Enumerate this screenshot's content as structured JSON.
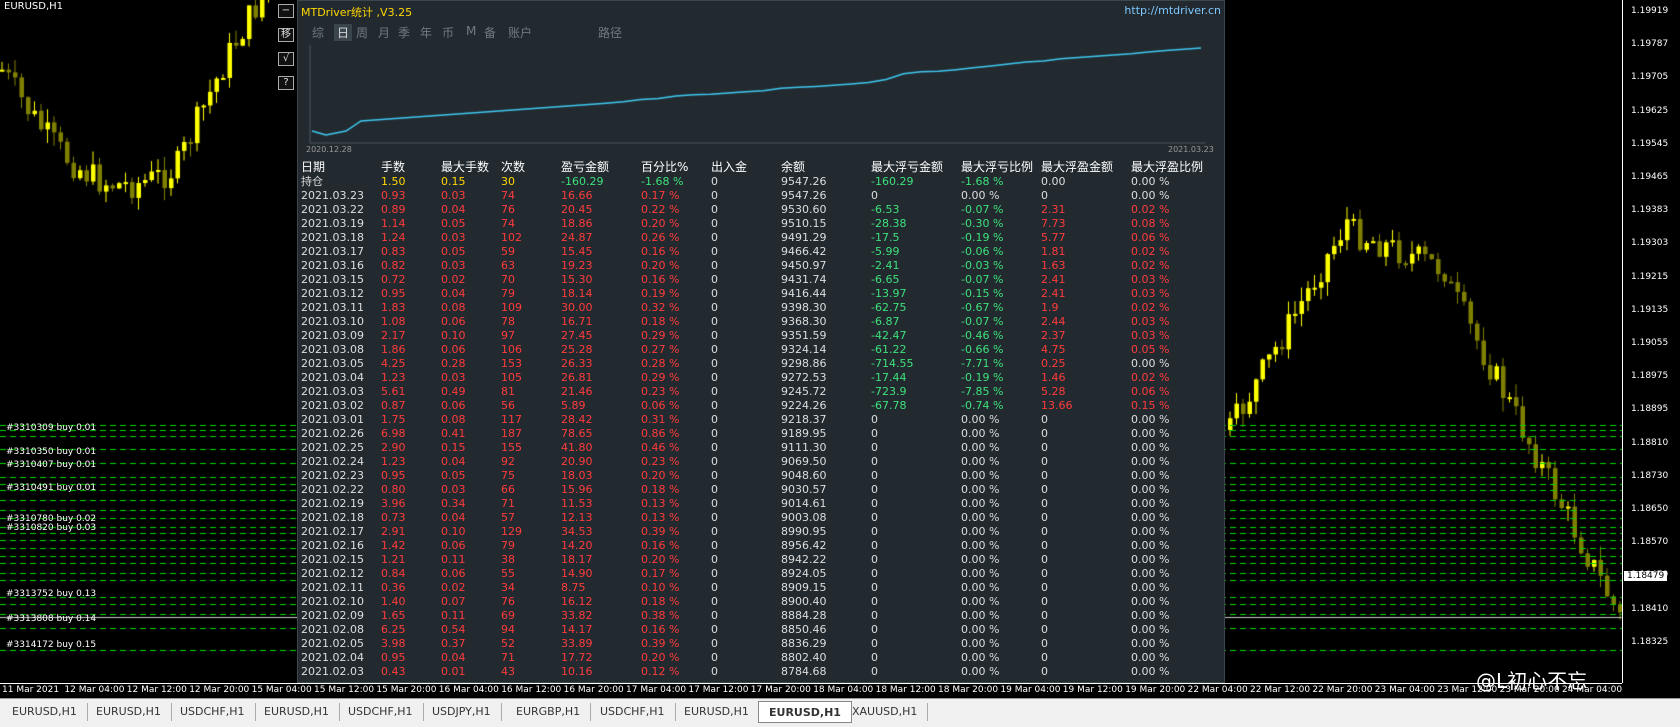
{
  "chart": {
    "title": "EURUSD,H1",
    "price_labels": [
      "1.19919",
      "1.19787",
      "1.19705",
      "1.19625",
      "1.19545",
      "1.19465",
      "1.19383",
      "1.19303",
      "1.19215",
      "1.19135",
      "1.19055",
      "1.18975",
      "1.18895",
      "1.18810",
      "1.18730",
      "1.18650",
      "1.18570",
      "1.18479",
      "1.18410",
      "1.18325"
    ],
    "current_price": "1.18479",
    "time_labels": [
      "11 Mar 2021",
      "12 Mar 04:00",
      "12 Mar 12:00",
      "12 Mar 20:00",
      "15 Mar 04:00",
      "15 Mar 12:00",
      "15 Mar 20:00",
      "16 Mar 04:00",
      "16 Mar 12:00",
      "16 Mar 20:00",
      "17 Mar 04:00",
      "17 Mar 12:00",
      "17 Mar 20:00",
      "18 Mar 04:00",
      "18 Mar 12:00",
      "18 Mar 20:00",
      "19 Mar 04:00",
      "19 Mar 12:00",
      "19 Mar 20:00",
      "22 Mar 04:00",
      "22 Mar 12:00",
      "22 Mar 20:00",
      "23 Mar 04:00",
      "23 Mar 12:00",
      "23 Mar 20:00",
      "24 Mar 04:00"
    ],
    "order_labels": [
      "#3310309 buy 0.01",
      "#3310350 buy 0.01",
      "#3310407 buy 0.01",
      "#3310491 buy 0.01",
      "#3310780 buy 0.02",
      "#3310820 buy 0.03",
      "#3313752 buy 0.13",
      "#3313808 buy 0.14",
      "#3314172 buy 0.15"
    ],
    "colors": {
      "bull": "#ffff00",
      "bear": "#808000",
      "order_line": "#00dd00"
    }
  },
  "tools": [
    "−",
    "移",
    "√",
    "?"
  ],
  "panel": {
    "title": "MTDriver统计 ,V3.25",
    "link": "http://mtdriver.cn",
    "tabs": [
      "综",
      "日",
      "周",
      "月",
      "季",
      "年",
      "币",
      "M",
      "备",
      "账户",
      "路径"
    ],
    "active_tab": "日",
    "mini_chart_start": "2020.12.28",
    "mini_chart_end": "2021.03.23",
    "headers": [
      "日期",
      "手数",
      "最大手数",
      "次数",
      "盈亏金额",
      "百分比%",
      "出入金",
      "余额",
      "最大浮亏金额",
      "最大浮亏比例",
      "最大浮盈金额",
      "最大浮盈比例"
    ],
    "holding": [
      "持仓",
      "1.50",
      "0.15",
      "30",
      "-160.29",
      "-1.68 %",
      "0",
      "9547.26",
      "-160.29",
      "-1.68 %",
      "0.00",
      "0.00 %"
    ],
    "rows": [
      [
        "2021.03.23",
        "0.93",
        "0.03",
        "74",
        "16.66",
        "0.17 %",
        "0",
        "9547.26",
        "0",
        "0.00 %",
        "0",
        "0.00 %"
      ],
      [
        "2021.03.22",
        "0.89",
        "0.04",
        "76",
        "20.45",
        "0.22 %",
        "0",
        "9530.60",
        "-6.53",
        "-0.07 %",
        "2.31",
        "0.02 %"
      ],
      [
        "2021.03.19",
        "1.14",
        "0.05",
        "74",
        "18.86",
        "0.20 %",
        "0",
        "9510.15",
        "-28.38",
        "-0.30 %",
        "7.73",
        "0.08 %"
      ],
      [
        "2021.03.18",
        "1.24",
        "0.03",
        "102",
        "24.87",
        "0.26 %",
        "0",
        "9491.29",
        "-17.5",
        "-0.19 %",
        "5.77",
        "0.06 %"
      ],
      [
        "2021.03.17",
        "0.83",
        "0.05",
        "59",
        "15.45",
        "0.16 %",
        "0",
        "9466.42",
        "-5.99",
        "-0.06 %",
        "1.81",
        "0.02 %"
      ],
      [
        "2021.03.16",
        "0.82",
        "0.03",
        "63",
        "19.23",
        "0.20 %",
        "0",
        "9450.97",
        "-2.41",
        "-0.03 %",
        "1.63",
        "0.02 %"
      ],
      [
        "2021.03.15",
        "0.72",
        "0.02",
        "70",
        "15.30",
        "0.16 %",
        "0",
        "9431.74",
        "-6.65",
        "-0.07 %",
        "2.41",
        "0.03 %"
      ],
      [
        "2021.03.12",
        "0.95",
        "0.04",
        "79",
        "18.14",
        "0.19 %",
        "0",
        "9416.44",
        "-13.97",
        "-0.15 %",
        "2.41",
        "0.03 %"
      ],
      [
        "2021.03.11",
        "1.83",
        "0.08",
        "109",
        "30.00",
        "0.32 %",
        "0",
        "9398.30",
        "-62.75",
        "-0.67 %",
        "1.9",
        "0.02 %"
      ],
      [
        "2021.03.10",
        "1.08",
        "0.06",
        "78",
        "16.71",
        "0.18 %",
        "0",
        "9368.30",
        "-6.87",
        "-0.07 %",
        "2.44",
        "0.03 %"
      ],
      [
        "2021.03.09",
        "2.17",
        "0.10",
        "97",
        "27.45",
        "0.29 %",
        "0",
        "9351.59",
        "-42.47",
        "-0.46 %",
        "2.37",
        "0.03 %"
      ],
      [
        "2021.03.08",
        "1.86",
        "0.06",
        "106",
        "25.28",
        "0.27 %",
        "0",
        "9324.14",
        "-61.22",
        "-0.66 %",
        "4.75",
        "0.05 %"
      ],
      [
        "2021.03.05",
        "4.25",
        "0.28",
        "153",
        "26.33",
        "0.28 %",
        "0",
        "9298.86",
        "-714.55",
        "-7.71 %",
        "0.25",
        "0.00 %"
      ],
      [
        "2021.03.04",
        "1.23",
        "0.03",
        "105",
        "26.81",
        "0.29 %",
        "0",
        "9272.53",
        "-17.44",
        "-0.19 %",
        "1.46",
        "0.02 %"
      ],
      [
        "2021.03.03",
        "5.61",
        "0.49",
        "81",
        "21.46",
        "0.23 %",
        "0",
        "9245.72",
        "-723.9",
        "-7.85 %",
        "5.28",
        "0.06 %"
      ],
      [
        "2021.03.02",
        "0.87",
        "0.06",
        "56",
        "5.89",
        "0.06 %",
        "0",
        "9224.26",
        "-67.78",
        "-0.74 %",
        "13.66",
        "0.15 %"
      ],
      [
        "2021.03.01",
        "1.75",
        "0.08",
        "117",
        "28.42",
        "0.31 %",
        "0",
        "9218.37",
        "0",
        "0.00 %",
        "0",
        "0.00 %"
      ],
      [
        "2021.02.26",
        "6.98",
        "0.41",
        "187",
        "78.65",
        "0.86 %",
        "0",
        "9189.95",
        "0",
        "0.00 %",
        "0",
        "0.00 %"
      ],
      [
        "2021.02.25",
        "2.90",
        "0.15",
        "155",
        "41.80",
        "0.46 %",
        "0",
        "9111.30",
        "0",
        "0.00 %",
        "0",
        "0.00 %"
      ],
      [
        "2021.02.24",
        "1.23",
        "0.04",
        "92",
        "20.90",
        "0.23 %",
        "0",
        "9069.50",
        "0",
        "0.00 %",
        "0",
        "0.00 %"
      ],
      [
        "2021.02.23",
        "0.95",
        "0.05",
        "75",
        "18.03",
        "0.20 %",
        "0",
        "9048.60",
        "0",
        "0.00 %",
        "0",
        "0.00 %"
      ],
      [
        "2021.02.22",
        "0.80",
        "0.03",
        "66",
        "15.96",
        "0.18 %",
        "0",
        "9030.57",
        "0",
        "0.00 %",
        "0",
        "0.00 %"
      ],
      [
        "2021.02.19",
        "3.96",
        "0.34",
        "71",
        "11.53",
        "0.13 %",
        "0",
        "9014.61",
        "0",
        "0.00 %",
        "0",
        "0.00 %"
      ],
      [
        "2021.02.18",
        "0.73",
        "0.04",
        "57",
        "12.13",
        "0.13 %",
        "0",
        "9003.08",
        "0",
        "0.00 %",
        "0",
        "0.00 %"
      ],
      [
        "2021.02.17",
        "2.91",
        "0.10",
        "129",
        "34.53",
        "0.39 %",
        "0",
        "8990.95",
        "0",
        "0.00 %",
        "0",
        "0.00 %"
      ],
      [
        "2021.02.16",
        "1.42",
        "0.06",
        "79",
        "14.20",
        "0.16 %",
        "0",
        "8956.42",
        "0",
        "0.00 %",
        "0",
        "0.00 %"
      ],
      [
        "2021.02.15",
        "1.21",
        "0.11",
        "38",
        "18.17",
        "0.20 %",
        "0",
        "8942.22",
        "0",
        "0.00 %",
        "0",
        "0.00 %"
      ],
      [
        "2021.02.12",
        "0.84",
        "0.06",
        "55",
        "14.90",
        "0.17 %",
        "0",
        "8924.05",
        "0",
        "0.00 %",
        "0",
        "0.00 %"
      ],
      [
        "2021.02.11",
        "0.36",
        "0.02",
        "34",
        "8.75",
        "0.10 %",
        "0",
        "8909.15",
        "0",
        "0.00 %",
        "0",
        "0.00 %"
      ],
      [
        "2021.02.10",
        "1.40",
        "0.07",
        "76",
        "16.12",
        "0.18 %",
        "0",
        "8900.40",
        "0",
        "0.00 %",
        "0",
        "0.00 %"
      ],
      [
        "2021.02.09",
        "1.65",
        "0.11",
        "69",
        "33.82",
        "0.38 %",
        "0",
        "8884.28",
        "0",
        "0.00 %",
        "0",
        "0.00 %"
      ],
      [
        "2021.02.08",
        "6.25",
        "0.54",
        "94",
        "14.17",
        "0.16 %",
        "0",
        "8850.46",
        "0",
        "0.00 %",
        "0",
        "0.00 %"
      ],
      [
        "2021.02.05",
        "3.98",
        "0.37",
        "52",
        "33.89",
        "0.39 %",
        "0",
        "8836.29",
        "0",
        "0.00 %",
        "0",
        "0.00 %"
      ],
      [
        "2021.02.04",
        "0.95",
        "0.04",
        "71",
        "17.72",
        "0.20 %",
        "0",
        "8802.40",
        "0",
        "0.00 %",
        "0",
        "0.00 %"
      ],
      [
        "2021.02.03",
        "0.43",
        "0.01",
        "43",
        "10.16",
        "0.12 %",
        "0",
        "8784.68",
        "0",
        "0.00 %",
        "0",
        "0.00 %"
      ]
    ]
  },
  "bottom_tabs": [
    "EURUSD,H1",
    "EURUSD,H1",
    "USDCHF,H1",
    "EURUSD,H1",
    "USDCHF,H1",
    "USDJPY,H1",
    "EURGBP,H1",
    "USDCHF,H1",
    "EURUSD,H1",
    "EURUSD,H1",
    "XAUUSD,H1"
  ],
  "active_tab_index": 9,
  "watermark": "@L初心不忘"
}
